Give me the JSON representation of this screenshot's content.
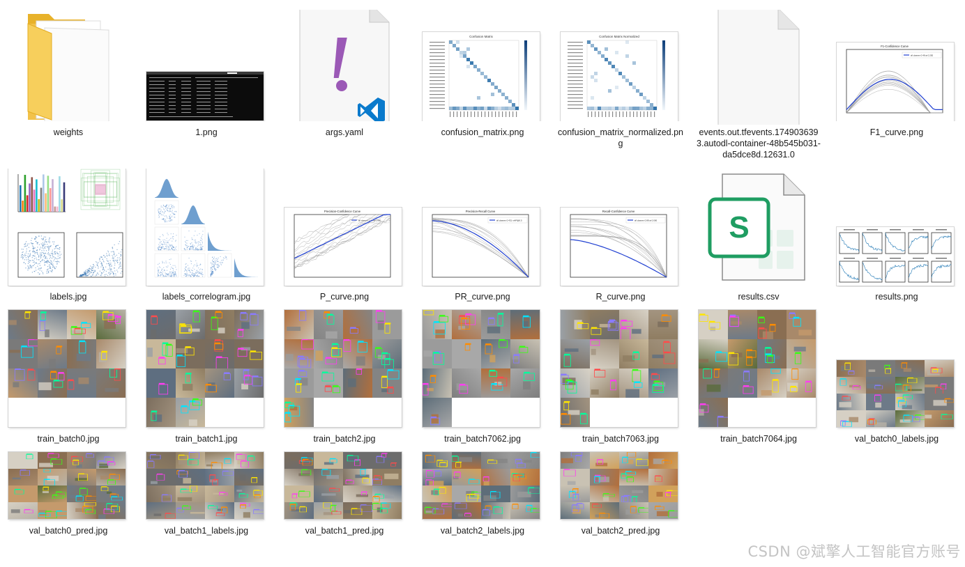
{
  "files": [
    {
      "key": "weights",
      "name": "weights",
      "type": "folder"
    },
    {
      "key": "png1",
      "name": "1.png",
      "type": "terminal-image"
    },
    {
      "key": "args",
      "name": "args.yaml",
      "type": "yaml-file"
    },
    {
      "key": "cm",
      "name": "confusion_matrix.png",
      "type": "matrix-image"
    },
    {
      "key": "cmn",
      "name": "confusion_matrix_normalized.png",
      "type": "matrix-image"
    },
    {
      "key": "events",
      "name": "events.out.tfevents.1749036393.autodl-container-48b545b031-da5dce8d.12631.0",
      "type": "blank-file"
    },
    {
      "key": "f1",
      "name": "F1_curve.png",
      "type": "curve-image"
    },
    {
      "key": "labels",
      "name": "labels.jpg",
      "type": "labels-image"
    },
    {
      "key": "corr",
      "name": "labels_correlogram.jpg",
      "type": "correlogram-image"
    },
    {
      "key": "p",
      "name": "P_curve.png",
      "type": "curve-image"
    },
    {
      "key": "pr",
      "name": "PR_curve.png",
      "type": "curve-image"
    },
    {
      "key": "r",
      "name": "R_curve.png",
      "type": "curve-image"
    },
    {
      "key": "csv",
      "name": "results.csv",
      "type": "spreadsheet-file"
    },
    {
      "key": "res",
      "name": "results.png",
      "type": "results-image"
    },
    {
      "key": "tb0",
      "name": "train_batch0.jpg",
      "type": "photo-grid"
    },
    {
      "key": "tb1",
      "name": "train_batch1.jpg",
      "type": "photo-grid"
    },
    {
      "key": "tb2",
      "name": "train_batch2.jpg",
      "type": "photo-grid"
    },
    {
      "key": "tb7062",
      "name": "train_batch7062.jpg",
      "type": "photo-grid"
    },
    {
      "key": "tb7063",
      "name": "train_batch7063.jpg",
      "type": "photo-grid"
    },
    {
      "key": "tb7064",
      "name": "train_batch7064.jpg",
      "type": "photo-grid"
    },
    {
      "key": "vb0l",
      "name": "val_batch0_labels.jpg",
      "type": "photo-grid"
    },
    {
      "key": "vb0p",
      "name": "val_batch0_pred.jpg",
      "type": "photo-grid"
    },
    {
      "key": "vb1l",
      "name": "val_batch1_labels.jpg",
      "type": "photo-grid"
    },
    {
      "key": "vb1p",
      "name": "val_batch1_pred.jpg",
      "type": "photo-grid"
    },
    {
      "key": "vb2l",
      "name": "val_batch2_labels.jpg",
      "type": "photo-grid"
    },
    {
      "key": "vb2p",
      "name": "val_batch2_pred.jpg",
      "type": "photo-grid"
    }
  ],
  "thumb_text": {
    "cm_title": "Confusion Matrix",
    "cmn_title": "Confusion Matrix Normalized",
    "f1_title": "F1-Confidence Curve",
    "f1_legend": "all classes 0.48 at 0.282",
    "p_title": "Precision-Confidence Curve",
    "p_legend": "all classes 1.00 at 0.960",
    "pr_title": "Precision-Recall Curve",
    "pr_legend": "all classes 0.431 mAP@0.5",
    "r_title": "Recall-Confidence Curve",
    "r_legend": "all classes 0.88 at 0.000",
    "csv_letter": "S",
    "yaml_glyph": "!"
  },
  "colors": {
    "folder": "#f5c84c",
    "folder_dark": "#e6a91f",
    "yaml_purple": "#9b59b6",
    "vscode_blue": "#0a7acc",
    "sheet_green": "#1f9d62",
    "curve_blue": "#1f3fd1",
    "matrix_blue": "#2b6fa8"
  },
  "watermark": "CSDN @斌擎人工智能官方账号"
}
